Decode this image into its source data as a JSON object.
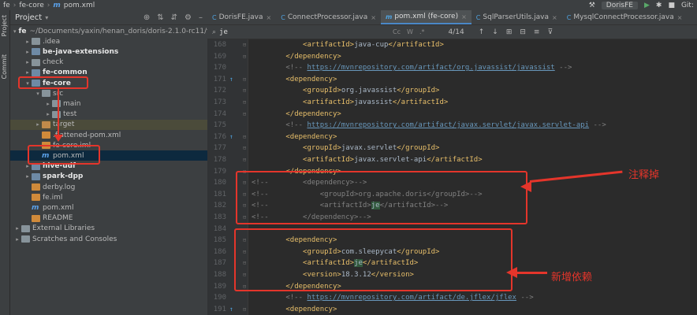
{
  "topbar": {
    "crumbs": [
      "fe",
      "fe-core",
      "pom.xml"
    ],
    "run_config": "DorisFE",
    "vcs": "Git:"
  },
  "left_stripe": {
    "project": "Project",
    "commit": "Commit"
  },
  "project": {
    "title": "Project",
    "rows": [
      {
        "label": "fe",
        "extra": "~/Documents/yaxin/henan_doris/doris-2.1.0-rc11/fe",
        "indent": 0,
        "arrow": "▾",
        "icon": "folder-mod",
        "bold": true
      },
      {
        "label": ".idea",
        "indent": 1,
        "arrow": "▸",
        "icon": "folder"
      },
      {
        "label": "be-java-extensions",
        "indent": 1,
        "arrow": "▸",
        "icon": "folder-mod",
        "bold": true
      },
      {
        "label": "check",
        "indent": 1,
        "arrow": "▸",
        "icon": "folder"
      },
      {
        "label": "fe-common",
        "indent": 1,
        "arrow": "▸",
        "icon": "folder-mod",
        "bold": true
      },
      {
        "label": "fe-core",
        "indent": 1,
        "arrow": "▾",
        "icon": "folder-mod",
        "bold": true
      },
      {
        "label": "src",
        "indent": 2,
        "arrow": "▾",
        "icon": "folder"
      },
      {
        "label": "main",
        "indent": 3,
        "arrow": "▸",
        "icon": "folder"
      },
      {
        "label": "test",
        "indent": 3,
        "arrow": "▸",
        "icon": "folder"
      },
      {
        "label": "target",
        "indent": 2,
        "arrow": "▸",
        "icon": "folder-orange",
        "highlight": true
      },
      {
        "label": ".flattened-pom.xml",
        "indent": 2,
        "arrow": "",
        "icon": "file-x"
      },
      {
        "label": "fe-core.iml",
        "indent": 2,
        "arrow": "",
        "icon": "file-x"
      },
      {
        "label": "pom.xml",
        "indent": 2,
        "arrow": "",
        "icon": "file-m",
        "selected": true
      },
      {
        "label": "hive-udf",
        "indent": 1,
        "arrow": "▸",
        "icon": "folder-mod",
        "bold": true
      },
      {
        "label": "spark-dpp",
        "indent": 1,
        "arrow": "▸",
        "icon": "folder-mod",
        "bold": true
      },
      {
        "label": "derby.log",
        "indent": 1,
        "arrow": "",
        "icon": "file-x"
      },
      {
        "label": "fe.iml",
        "indent": 1,
        "arrow": "",
        "icon": "file-x"
      },
      {
        "label": "pom.xml",
        "indent": 1,
        "arrow": "",
        "icon": "file-m"
      },
      {
        "label": "README",
        "indent": 1,
        "arrow": "",
        "icon": "file-x"
      },
      {
        "label": "External Libraries",
        "indent": 0,
        "arrow": "▸",
        "icon": "folder"
      },
      {
        "label": "Scratches and Consoles",
        "indent": 0,
        "arrow": "▸",
        "icon": "folder"
      }
    ]
  },
  "tabs": [
    {
      "label": "DorisFE.java",
      "icon": "C",
      "active": false
    },
    {
      "label": "ConnectProcessor.java",
      "icon": "C",
      "active": false
    },
    {
      "label": "pom.xml (fe-core)",
      "icon": "m",
      "active": true
    },
    {
      "label": "SqlParserUtils.java",
      "icon": "C",
      "active": false
    },
    {
      "label": "MysqlConnectProcessor.java",
      "icon": "C",
      "active": false
    }
  ],
  "search": {
    "value": "je",
    "options": [
      "Cc",
      "W",
      ".*"
    ],
    "count": "4/14"
  },
  "editor": {
    "lines": [
      {
        "n": "168",
        "segs": [
          [
            "txt",
            "            "
          ],
          [
            "tag",
            "<artifactId>"
          ],
          [
            "txt",
            "java-cup"
          ],
          [
            "tag",
            "</artifactId>"
          ]
        ]
      },
      {
        "n": "169",
        "segs": [
          [
            "txt",
            "        "
          ],
          [
            "tag",
            "</dependency>"
          ]
        ]
      },
      {
        "n": "170",
        "segs": [
          [
            "cmt",
            "        <!-- "
          ],
          [
            "url",
            "https://mvnrepository.com/artifact/org.javassist/javassist"
          ],
          [
            "cmt",
            " -->"
          ]
        ]
      },
      {
        "n": "171",
        "icon": "↑",
        "segs": [
          [
            "txt",
            "        "
          ],
          [
            "tag",
            "<dependency>"
          ]
        ]
      },
      {
        "n": "172",
        "segs": [
          [
            "txt",
            "            "
          ],
          [
            "tag",
            "<groupId>"
          ],
          [
            "txt",
            "org.javassist"
          ],
          [
            "tag",
            "</groupId>"
          ]
        ]
      },
      {
        "n": "173",
        "segs": [
          [
            "txt",
            "            "
          ],
          [
            "tag",
            "<artifactId>"
          ],
          [
            "txt",
            "javassist"
          ],
          [
            "tag",
            "</artifactId>"
          ]
        ]
      },
      {
        "n": "174",
        "segs": [
          [
            "txt",
            "        "
          ],
          [
            "tag",
            "</dependency>"
          ]
        ]
      },
      {
        "n": "175",
        "segs": [
          [
            "cmt",
            "        <!-- "
          ],
          [
            "url",
            "https://mvnrepository.com/artifact/javax.servlet/javax.servlet-api"
          ],
          [
            "cmt",
            " -->"
          ]
        ]
      },
      {
        "n": "176",
        "icon": "↑",
        "segs": [
          [
            "txt",
            "        "
          ],
          [
            "tag",
            "<dependency>"
          ]
        ]
      },
      {
        "n": "177",
        "segs": [
          [
            "txt",
            "            "
          ],
          [
            "tag",
            "<groupId>"
          ],
          [
            "txt",
            "javax.servlet"
          ],
          [
            "tag",
            "</groupId>"
          ]
        ]
      },
      {
        "n": "178",
        "segs": [
          [
            "txt",
            "            "
          ],
          [
            "tag",
            "<artifactId>"
          ],
          [
            "txt",
            "javax.servlet-api"
          ],
          [
            "tag",
            "</artifactId>"
          ]
        ]
      },
      {
        "n": "179",
        "segs": [
          [
            "txt",
            "        "
          ],
          [
            "tag",
            "</dependency>"
          ]
        ]
      },
      {
        "n": "180",
        "segs": [
          [
            "cmt",
            "<!--        <dependency>-->"
          ]
        ]
      },
      {
        "n": "181",
        "segs": [
          [
            "cmt",
            "<!--            <groupId>org.apache.doris</groupId>-->"
          ]
        ]
      },
      {
        "n": "182",
        "segs": [
          [
            "cmt",
            "<!--            <artifactId>"
          ],
          [
            "hit",
            "je"
          ],
          [
            "cmt",
            "</artifactId>-->"
          ]
        ]
      },
      {
        "n": "183",
        "segs": [
          [
            "cmt",
            "<!--        </dependency>-->"
          ]
        ]
      },
      {
        "n": "184",
        "segs": [
          [
            "txt",
            ""
          ]
        ]
      },
      {
        "n": "185",
        "segs": [
          [
            "txt",
            "        "
          ],
          [
            "tag",
            "<dependency>"
          ]
        ]
      },
      {
        "n": "186",
        "segs": [
          [
            "txt",
            "            "
          ],
          [
            "tag",
            "<groupId>"
          ],
          [
            "txt",
            "com.sleepycat"
          ],
          [
            "tag",
            "</groupId>"
          ]
        ]
      },
      {
        "n": "187",
        "segs": [
          [
            "txt",
            "            "
          ],
          [
            "tag",
            "<artifactId>"
          ],
          [
            "hit",
            "je"
          ],
          [
            "tag",
            "</artifactId>"
          ]
        ]
      },
      {
        "n": "188",
        "segs": [
          [
            "txt",
            "            "
          ],
          [
            "tag",
            "<version>"
          ],
          [
            "txt",
            "18.3.12"
          ],
          [
            "tag",
            "</version>"
          ]
        ]
      },
      {
        "n": "189",
        "segs": [
          [
            "txt",
            "        "
          ],
          [
            "tag",
            "</dependency>"
          ]
        ]
      },
      {
        "n": "190",
        "segs": [
          [
            "cmt",
            "        <!-- "
          ],
          [
            "url",
            "https://mvnrepository.com/artifact/de.jflex/jflex"
          ],
          [
            "cmt",
            " -->"
          ]
        ]
      },
      {
        "n": "191",
        "icon": "↑",
        "segs": [
          [
            "txt",
            "        "
          ],
          [
            "tag",
            "<dependency>"
          ]
        ]
      }
    ]
  },
  "annotations": {
    "comment_out": "注释掉",
    "add_dependency": "新增依赖"
  },
  "colors": {
    "annotation": "#e4352b",
    "accent": "#4a88c7"
  }
}
